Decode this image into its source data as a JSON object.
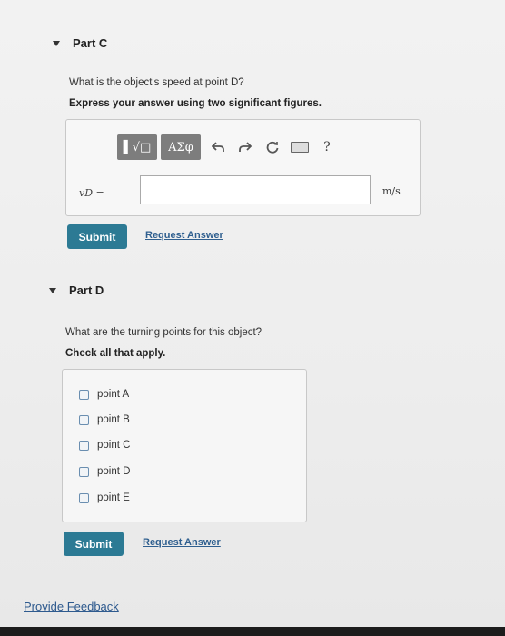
{
  "part_c": {
    "title": "Part C",
    "question": "What is the object's speed at point D?",
    "instruction": "Express your answer using two significant figures.",
    "toolbar": {
      "math_button": "▌√□",
      "greek_button": "ΑΣφ",
      "help": "?"
    },
    "variable_label": "vD =",
    "answer_value": "",
    "unit": "m/s",
    "submit_label": "Submit",
    "request_answer_label": "Request Answer"
  },
  "part_d": {
    "title": "Part D",
    "question": "What are the turning points for this object?",
    "instruction": "Check all that apply.",
    "options": [
      "point A",
      "point B",
      "point C",
      "point D",
      "point E"
    ],
    "submit_label": "Submit",
    "request_answer_label": "Request Answer"
  },
  "footer": {
    "feedback_label": "Provide Feedback"
  }
}
